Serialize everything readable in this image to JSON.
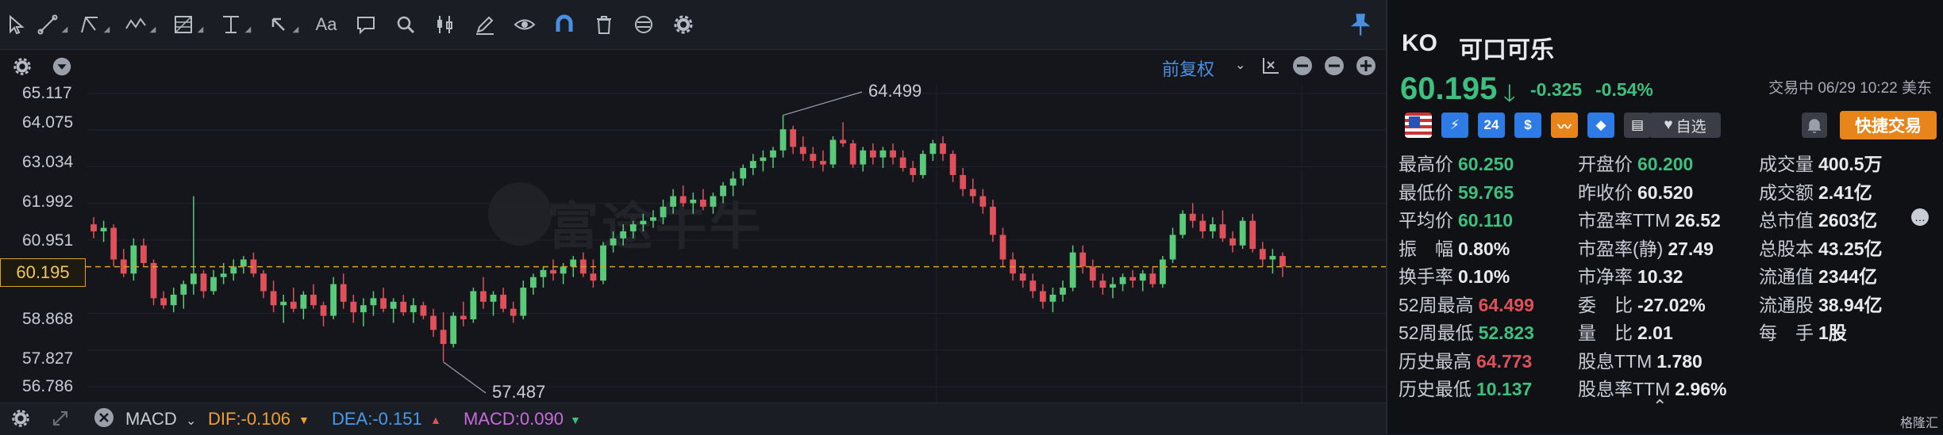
{
  "chart": {
    "price_axis": [
      "65.117",
      "64.075",
      "63.034",
      "61.992",
      "60.951",
      "60.195",
      "58.868",
      "57.827",
      "56.786"
    ],
    "current_price": "60.195",
    "high_annotation": "64.499",
    "low_annotation": "57.487",
    "fuquan_label": "前复权",
    "watermark": "富途牛牛",
    "candles": [
      {
        "o": 61.4,
        "h": 61.6,
        "l": 61.0,
        "c": 61.2
      },
      {
        "o": 61.2,
        "h": 61.5,
        "l": 60.9,
        "c": 61.3
      },
      {
        "o": 61.3,
        "h": 61.4,
        "l": 60.2,
        "c": 60.4
      },
      {
        "o": 60.4,
        "h": 60.7,
        "l": 59.9,
        "c": 60.0
      },
      {
        "o": 60.0,
        "h": 61.0,
        "l": 59.8,
        "c": 60.8
      },
      {
        "o": 60.8,
        "h": 61.0,
        "l": 60.2,
        "c": 60.3
      },
      {
        "o": 60.3,
        "h": 60.4,
        "l": 59.1,
        "c": 59.3
      },
      {
        "o": 59.3,
        "h": 59.5,
        "l": 59.0,
        "c": 59.1
      },
      {
        "o": 59.1,
        "h": 59.6,
        "l": 58.9,
        "c": 59.4
      },
      {
        "o": 59.4,
        "h": 59.8,
        "l": 59.0,
        "c": 59.7
      },
      {
        "o": 59.7,
        "h": 62.2,
        "l": 59.4,
        "c": 60.0
      },
      {
        "o": 60.0,
        "h": 60.1,
        "l": 59.3,
        "c": 59.5
      },
      {
        "o": 59.5,
        "h": 60.1,
        "l": 59.4,
        "c": 59.9
      },
      {
        "o": 59.9,
        "h": 60.3,
        "l": 59.7,
        "c": 60.0
      },
      {
        "o": 60.0,
        "h": 60.4,
        "l": 59.8,
        "c": 60.2
      },
      {
        "o": 60.2,
        "h": 60.5,
        "l": 60.0,
        "c": 60.4
      },
      {
        "o": 60.4,
        "h": 60.6,
        "l": 59.9,
        "c": 60.0
      },
      {
        "o": 60.0,
        "h": 60.1,
        "l": 59.3,
        "c": 59.5
      },
      {
        "o": 59.5,
        "h": 59.8,
        "l": 58.9,
        "c": 59.1
      },
      {
        "o": 59.1,
        "h": 59.4,
        "l": 58.6,
        "c": 59.2
      },
      {
        "o": 59.2,
        "h": 59.6,
        "l": 58.9,
        "c": 59.0
      },
      {
        "o": 59.0,
        "h": 59.5,
        "l": 58.7,
        "c": 59.4
      },
      {
        "o": 59.4,
        "h": 59.7,
        "l": 59.0,
        "c": 59.1
      },
      {
        "o": 59.1,
        "h": 59.2,
        "l": 58.5,
        "c": 58.8
      },
      {
        "o": 58.8,
        "h": 59.9,
        "l": 58.7,
        "c": 59.7
      },
      {
        "o": 59.7,
        "h": 60.0,
        "l": 59.0,
        "c": 59.2
      },
      {
        "o": 59.2,
        "h": 59.4,
        "l": 58.6,
        "c": 58.9
      },
      {
        "o": 58.9,
        "h": 59.3,
        "l": 58.5,
        "c": 59.1
      },
      {
        "o": 59.1,
        "h": 59.5,
        "l": 58.8,
        "c": 59.3
      },
      {
        "o": 59.3,
        "h": 59.6,
        "l": 58.9,
        "c": 59.0
      },
      {
        "o": 59.0,
        "h": 59.3,
        "l": 58.6,
        "c": 59.2
      },
      {
        "o": 59.2,
        "h": 59.4,
        "l": 58.8,
        "c": 58.9
      },
      {
        "o": 58.9,
        "h": 59.3,
        "l": 58.6,
        "c": 59.1
      },
      {
        "o": 59.1,
        "h": 59.2,
        "l": 58.7,
        "c": 58.8
      },
      {
        "o": 58.8,
        "h": 59.0,
        "l": 58.2,
        "c": 58.4
      },
      {
        "o": 58.4,
        "h": 58.9,
        "l": 57.5,
        "c": 58.0
      },
      {
        "o": 58.0,
        "h": 58.9,
        "l": 57.9,
        "c": 58.8
      },
      {
        "o": 58.8,
        "h": 59.2,
        "l": 58.5,
        "c": 58.7
      },
      {
        "o": 58.7,
        "h": 59.6,
        "l": 58.6,
        "c": 59.5
      },
      {
        "o": 59.5,
        "h": 59.9,
        "l": 59.0,
        "c": 59.2
      },
      {
        "o": 59.2,
        "h": 59.5,
        "l": 58.8,
        "c": 59.4
      },
      {
        "o": 59.4,
        "h": 59.6,
        "l": 58.9,
        "c": 59.0
      },
      {
        "o": 59.0,
        "h": 59.2,
        "l": 58.6,
        "c": 58.8
      },
      {
        "o": 58.8,
        "h": 59.8,
        "l": 58.7,
        "c": 59.6
      },
      {
        "o": 59.6,
        "h": 60.0,
        "l": 59.4,
        "c": 59.9
      },
      {
        "o": 59.9,
        "h": 60.2,
        "l": 59.6,
        "c": 60.1
      },
      {
        "o": 60.1,
        "h": 60.4,
        "l": 59.8,
        "c": 60.0
      },
      {
        "o": 60.0,
        "h": 60.3,
        "l": 59.7,
        "c": 60.2
      },
      {
        "o": 60.2,
        "h": 60.5,
        "l": 59.9,
        "c": 60.4
      },
      {
        "o": 60.4,
        "h": 60.6,
        "l": 59.9,
        "c": 60.0
      },
      {
        "o": 60.0,
        "h": 60.4,
        "l": 59.6,
        "c": 59.8
      },
      {
        "o": 59.8,
        "h": 60.9,
        "l": 59.7,
        "c": 60.8
      },
      {
        "o": 60.8,
        "h": 61.2,
        "l": 60.6,
        "c": 61.0
      },
      {
        "o": 61.0,
        "h": 61.4,
        "l": 60.8,
        "c": 61.2
      },
      {
        "o": 61.2,
        "h": 61.5,
        "l": 61.0,
        "c": 61.4
      },
      {
        "o": 61.4,
        "h": 61.7,
        "l": 61.2,
        "c": 61.5
      },
      {
        "o": 61.5,
        "h": 61.8,
        "l": 61.3,
        "c": 61.6
      },
      {
        "o": 61.6,
        "h": 62.1,
        "l": 61.4,
        "c": 61.9
      },
      {
        "o": 61.9,
        "h": 62.4,
        "l": 61.7,
        "c": 62.2
      },
      {
        "o": 62.2,
        "h": 62.5,
        "l": 61.9,
        "c": 62.0
      },
      {
        "o": 62.0,
        "h": 62.3,
        "l": 61.7,
        "c": 62.1
      },
      {
        "o": 62.1,
        "h": 62.4,
        "l": 61.8,
        "c": 61.9
      },
      {
        "o": 61.9,
        "h": 62.3,
        "l": 61.7,
        "c": 62.2
      },
      {
        "o": 62.2,
        "h": 62.6,
        "l": 62.0,
        "c": 62.5
      },
      {
        "o": 62.5,
        "h": 62.9,
        "l": 62.2,
        "c": 62.7
      },
      {
        "o": 62.7,
        "h": 63.1,
        "l": 62.5,
        "c": 63.0
      },
      {
        "o": 63.0,
        "h": 63.4,
        "l": 62.8,
        "c": 63.2
      },
      {
        "o": 63.2,
        "h": 63.5,
        "l": 62.9,
        "c": 63.3
      },
      {
        "o": 63.3,
        "h": 63.6,
        "l": 63.0,
        "c": 63.5
      },
      {
        "o": 63.5,
        "h": 64.5,
        "l": 63.3,
        "c": 64.1
      },
      {
        "o": 64.1,
        "h": 64.2,
        "l": 63.4,
        "c": 63.6
      },
      {
        "o": 63.6,
        "h": 63.9,
        "l": 63.2,
        "c": 63.4
      },
      {
        "o": 63.4,
        "h": 63.6,
        "l": 63.0,
        "c": 63.2
      },
      {
        "o": 63.2,
        "h": 63.5,
        "l": 62.9,
        "c": 63.1
      },
      {
        "o": 63.1,
        "h": 63.9,
        "l": 63.0,
        "c": 63.8
      },
      {
        "o": 63.8,
        "h": 64.3,
        "l": 63.6,
        "c": 63.7
      },
      {
        "o": 63.7,
        "h": 63.8,
        "l": 63.0,
        "c": 63.1
      },
      {
        "o": 63.1,
        "h": 63.6,
        "l": 62.9,
        "c": 63.5
      },
      {
        "o": 63.5,
        "h": 63.7,
        "l": 63.1,
        "c": 63.3
      },
      {
        "o": 63.3,
        "h": 63.6,
        "l": 63.0,
        "c": 63.5
      },
      {
        "o": 63.5,
        "h": 63.7,
        "l": 63.1,
        "c": 63.3
      },
      {
        "o": 63.3,
        "h": 63.5,
        "l": 62.9,
        "c": 63.0
      },
      {
        "o": 63.0,
        "h": 63.2,
        "l": 62.6,
        "c": 62.8
      },
      {
        "o": 62.8,
        "h": 63.5,
        "l": 62.7,
        "c": 63.4
      },
      {
        "o": 63.4,
        "h": 63.8,
        "l": 63.2,
        "c": 63.7
      },
      {
        "o": 63.7,
        "h": 63.9,
        "l": 63.2,
        "c": 63.4
      },
      {
        "o": 63.4,
        "h": 63.5,
        "l": 62.6,
        "c": 62.8
      },
      {
        "o": 62.8,
        "h": 63.0,
        "l": 62.2,
        "c": 62.4
      },
      {
        "o": 62.4,
        "h": 62.7,
        "l": 62.0,
        "c": 62.2
      },
      {
        "o": 62.2,
        "h": 62.4,
        "l": 61.7,
        "c": 61.9
      },
      {
        "o": 61.9,
        "h": 62.1,
        "l": 60.9,
        "c": 61.1
      },
      {
        "o": 61.1,
        "h": 61.3,
        "l": 60.2,
        "c": 60.4
      },
      {
        "o": 60.4,
        "h": 60.6,
        "l": 59.8,
        "c": 60.0
      },
      {
        "o": 60.0,
        "h": 60.2,
        "l": 59.6,
        "c": 59.8
      },
      {
        "o": 59.8,
        "h": 60.0,
        "l": 59.3,
        "c": 59.5
      },
      {
        "o": 59.5,
        "h": 59.7,
        "l": 59.0,
        "c": 59.2
      },
      {
        "o": 59.2,
        "h": 59.6,
        "l": 58.9,
        "c": 59.4
      },
      {
        "o": 59.4,
        "h": 59.8,
        "l": 59.2,
        "c": 59.6
      },
      {
        "o": 59.6,
        "h": 60.8,
        "l": 59.5,
        "c": 60.6
      },
      {
        "o": 60.6,
        "h": 60.8,
        "l": 60.0,
        "c": 60.2
      },
      {
        "o": 60.2,
        "h": 60.4,
        "l": 59.6,
        "c": 59.8
      },
      {
        "o": 59.8,
        "h": 60.0,
        "l": 59.4,
        "c": 59.6
      },
      {
        "o": 59.6,
        "h": 59.9,
        "l": 59.3,
        "c": 59.7
      },
      {
        "o": 59.7,
        "h": 60.0,
        "l": 59.5,
        "c": 59.9
      },
      {
        "o": 59.9,
        "h": 60.1,
        "l": 59.6,
        "c": 59.8
      },
      {
        "o": 59.8,
        "h": 60.1,
        "l": 59.5,
        "c": 60.0
      },
      {
        "o": 60.0,
        "h": 60.2,
        "l": 59.6,
        "c": 59.7
      },
      {
        "o": 59.7,
        "h": 60.5,
        "l": 59.6,
        "c": 60.4
      },
      {
        "o": 60.4,
        "h": 61.3,
        "l": 60.3,
        "c": 61.1
      },
      {
        "o": 61.1,
        "h": 61.8,
        "l": 61.0,
        "c": 61.7
      },
      {
        "o": 61.7,
        "h": 62.0,
        "l": 61.3,
        "c": 61.5
      },
      {
        "o": 61.5,
        "h": 61.7,
        "l": 61.0,
        "c": 61.2
      },
      {
        "o": 61.2,
        "h": 61.6,
        "l": 61.0,
        "c": 61.4
      },
      {
        "o": 61.4,
        "h": 61.8,
        "l": 60.9,
        "c": 61.0
      },
      {
        "o": 61.0,
        "h": 61.2,
        "l": 60.6,
        "c": 60.8
      },
      {
        "o": 60.8,
        "h": 61.6,
        "l": 60.7,
        "c": 61.5
      },
      {
        "o": 61.5,
        "h": 61.7,
        "l": 60.6,
        "c": 60.7
      },
      {
        "o": 60.7,
        "h": 60.9,
        "l": 60.2,
        "c": 60.4
      },
      {
        "o": 60.4,
        "h": 60.7,
        "l": 60.0,
        "c": 60.5
      },
      {
        "o": 60.5,
        "h": 60.6,
        "l": 59.9,
        "c": 60.2
      }
    ]
  },
  "toolbar": {
    "text_tool": "Aa"
  },
  "indicator": {
    "name": "MACD",
    "dif": "DIF:-0.106",
    "dea": "DEA:-0.151",
    "macd": "MACD:0.090"
  },
  "quote": {
    "symbol": "KO",
    "name": "可口可乐",
    "price": "60.195",
    "change": "-0.325",
    "change_pct": "-0.54%",
    "status": "交易中 06/29 10:22 美东",
    "favorite_label": "自选",
    "trade_label": "快捷交易",
    "collapse": "⌃",
    "footer_logo": "格隆汇",
    "icons": [
      {
        "name": "us-flag-icon",
        "text": "",
        "color": "#2c4fb8"
      },
      {
        "name": "lightning-icon",
        "text": "⚡",
        "color": "#2f7be6"
      },
      {
        "name": "24h-icon",
        "text": "24",
        "color": "#2f7be6"
      },
      {
        "name": "dollar-icon",
        "text": "$",
        "color": "#2f7be6"
      },
      {
        "name": "trend-icon",
        "text": "〰",
        "color": "#e8851a"
      },
      {
        "name": "tag-icon",
        "text": "◆",
        "color": "#2f7be6"
      },
      {
        "name": "doc-icon",
        "text": "▤",
        "color": "#3a3d45"
      }
    ],
    "stats": [
      [
        {
          "k": "最高价",
          "v": "60.250",
          "c": "green"
        },
        {
          "k": "开盘价",
          "v": "60.200",
          "c": "green"
        },
        {
          "k": "成交量",
          "v": "400.5万",
          "c": ""
        }
      ],
      [
        {
          "k": "最低价",
          "v": "59.765",
          "c": "green"
        },
        {
          "k": "昨收价",
          "v": "60.520",
          "c": ""
        },
        {
          "k": "成交额",
          "v": "2.41亿",
          "c": ""
        }
      ],
      [
        {
          "k": "平均价",
          "v": "60.110",
          "c": "green"
        },
        {
          "k": "市盈率TTM",
          "v": "26.52",
          "c": ""
        },
        {
          "k": "总市值",
          "v": "2603亿",
          "c": ""
        }
      ],
      [
        {
          "k": "振　幅",
          "v": "0.80%",
          "c": ""
        },
        {
          "k": "市盈率(静)",
          "v": "27.49",
          "c": ""
        },
        {
          "k": "总股本",
          "v": "43.25亿",
          "c": ""
        }
      ],
      [
        {
          "k": "换手率",
          "v": "0.10%",
          "c": ""
        },
        {
          "k": "市净率",
          "v": "10.32",
          "c": ""
        },
        {
          "k": "流通值",
          "v": "2344亿",
          "c": ""
        }
      ],
      [
        {
          "k": "52周最高",
          "v": "64.499",
          "c": "red"
        },
        {
          "k": "委　比",
          "v": "-27.02%",
          "c": ""
        },
        {
          "k": "流通股",
          "v": "38.94亿",
          "c": ""
        }
      ],
      [
        {
          "k": "52周最低",
          "v": "52.823",
          "c": "green"
        },
        {
          "k": "量　比",
          "v": "2.01",
          "c": ""
        },
        {
          "k": "每　手",
          "v": "1股",
          "c": ""
        }
      ],
      [
        {
          "k": "历史最高",
          "v": "64.773",
          "c": "red"
        },
        {
          "k": "股息TTM",
          "v": "1.780",
          "c": ""
        },
        null
      ],
      [
        {
          "k": "历史最低",
          "v": "10.137",
          "c": "green"
        },
        {
          "k": "股息率TTM",
          "v": "2.96%",
          "c": ""
        },
        null
      ]
    ]
  }
}
